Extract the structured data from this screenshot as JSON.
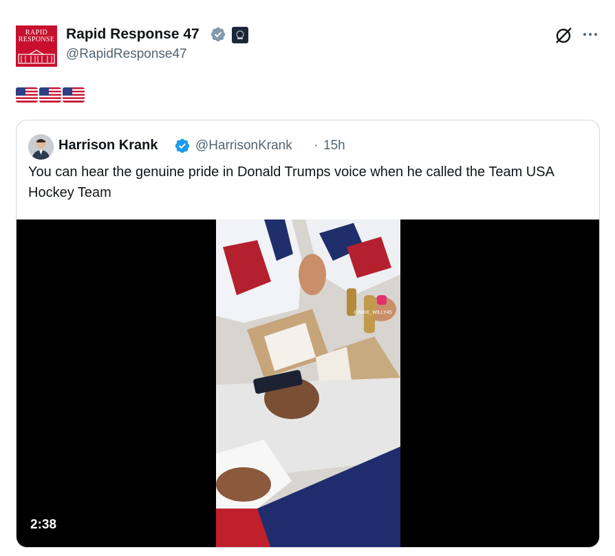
{
  "post": {
    "author_avatar_text": [
      "RAPID",
      "RESPONSE"
    ],
    "author_name": "Rapid Response 47",
    "author_handle": "@RapidResponse47",
    "flags": "🇺🇸🇺🇸🇺🇸"
  },
  "quoted": {
    "author_name": "Harrison Krank",
    "author_handle": "@HarrisonKrank",
    "separator": "·",
    "time": "15h",
    "text": "You can hear the genuine pride in Donald Trumps voice when he called the Team USA Hockey Team",
    "video": {
      "duration": "2:38",
      "overlay_handle": "@NIKE_WILLY45"
    }
  },
  "icons": {
    "verified_gray": "verified-badge-icon",
    "verified_blue": "verified-badge-icon",
    "grok": "grok-icon",
    "more": "more-icon"
  },
  "colors": {
    "text": "#0f1419",
    "secondary": "#536471",
    "border": "#cfd9de",
    "blue_verified": "#1d9bf0",
    "gray_verified": "#829aab",
    "avatar_red": "#c8102e"
  }
}
